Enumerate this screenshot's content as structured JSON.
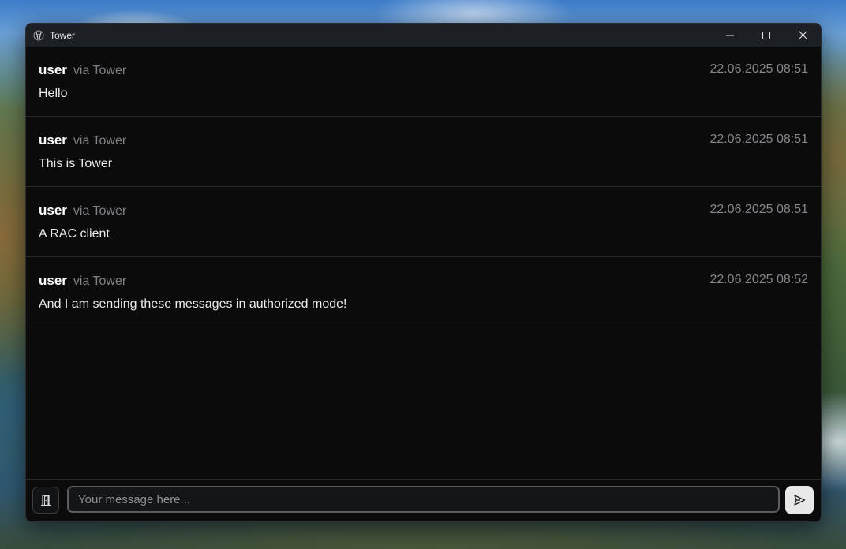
{
  "window": {
    "title": "Tower",
    "app_icon": "tower-logo-icon",
    "controls": [
      "minimize-icon",
      "maximize-icon",
      "close-icon"
    ]
  },
  "messages": [
    {
      "user": "user",
      "via": "via Tower",
      "time": "22.06.2025 08:51",
      "text": "Hello"
    },
    {
      "user": "user",
      "via": "via Tower",
      "time": "22.06.2025 08:51",
      "text": "This is Tower"
    },
    {
      "user": "user",
      "via": "via Tower",
      "time": "22.06.2025 08:51",
      "text": "A RAC client"
    },
    {
      "user": "user",
      "via": "via Tower",
      "time": "22.06.2025 08:52",
      "text": "And I am sending these messages in authorized mode!"
    }
  ],
  "composer": {
    "side_button_icon": "door-icon",
    "input_value": "",
    "input_placeholder": "Your message here...",
    "send_icon": "send-icon"
  },
  "colors": {
    "window_bg": "#0b0b0c",
    "titlebar_bg": "#1c1f24",
    "muted_text": "#7f8186",
    "send_button_bg": "#e8e8e8"
  }
}
